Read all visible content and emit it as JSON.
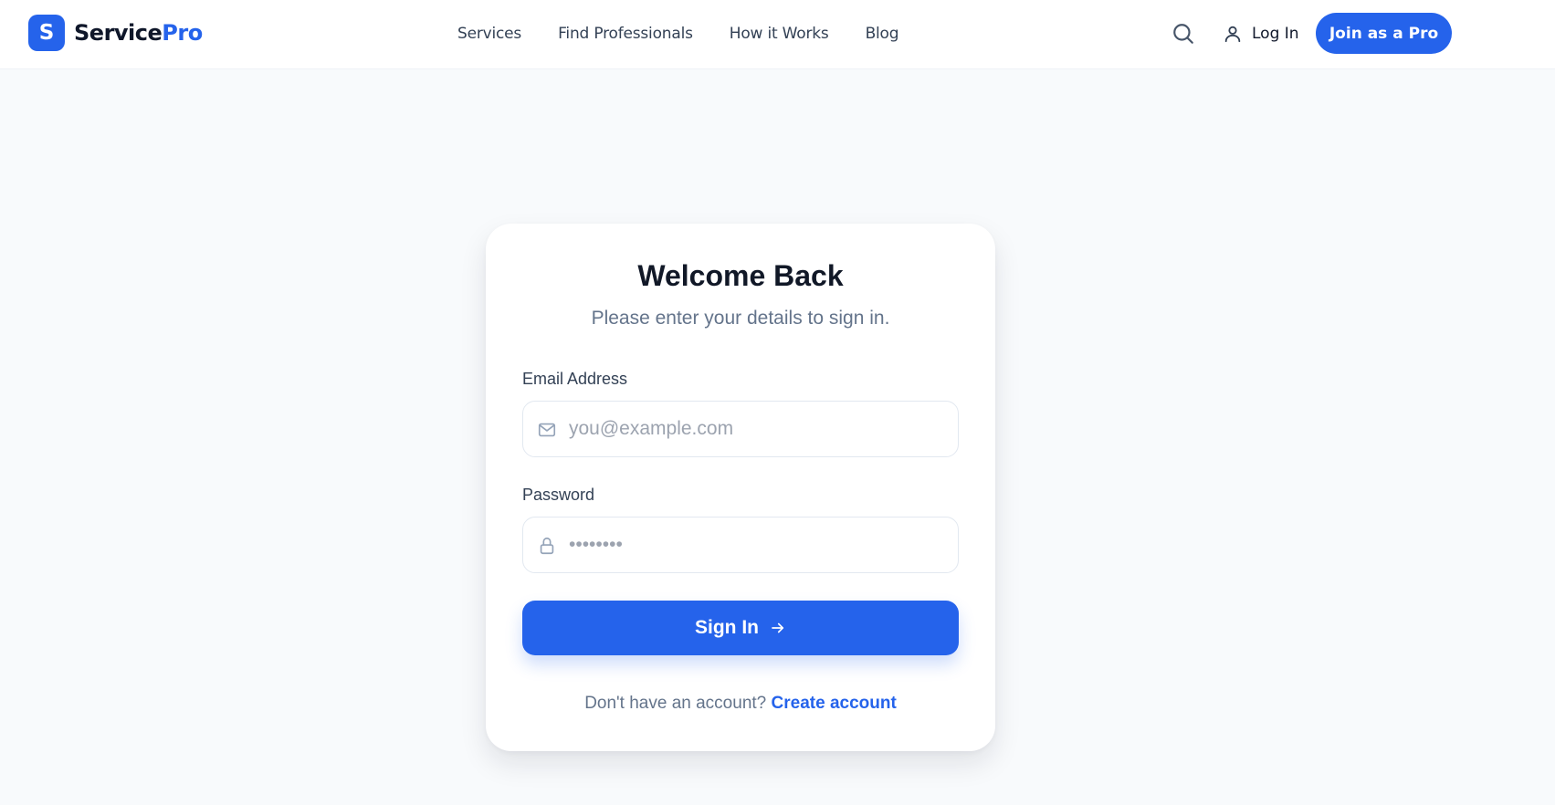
{
  "header": {
    "brand_letter": "S",
    "brand_main": "Service",
    "brand_accent": "Pro",
    "nav": [
      {
        "label": "Services"
      },
      {
        "label": "Find Professionals"
      },
      {
        "label": "How it Works"
      },
      {
        "label": "Blog"
      }
    ],
    "login_label": "Log In",
    "join_label": "Join as a Pro"
  },
  "login_card": {
    "title": "Welcome Back",
    "subtitle": "Please enter your details to sign in.",
    "email": {
      "label": "Email Address",
      "placeholder": "you@example.com",
      "value": ""
    },
    "password": {
      "label": "Password",
      "placeholder": "••••••••",
      "value": ""
    },
    "submit_label": "Sign In",
    "signup_prompt": "Don't have an account?",
    "signup_link": "Create account"
  },
  "colors": {
    "accent": "#2563eb",
    "background": "#f8fafc",
    "card": "#ffffff",
    "text_primary": "#111827",
    "text_muted": "#64748b"
  },
  "icons": {
    "search": "search-icon",
    "user": "user-icon",
    "email": "mail-icon",
    "password": "lock-icon",
    "submit": "arrow-right-icon"
  }
}
